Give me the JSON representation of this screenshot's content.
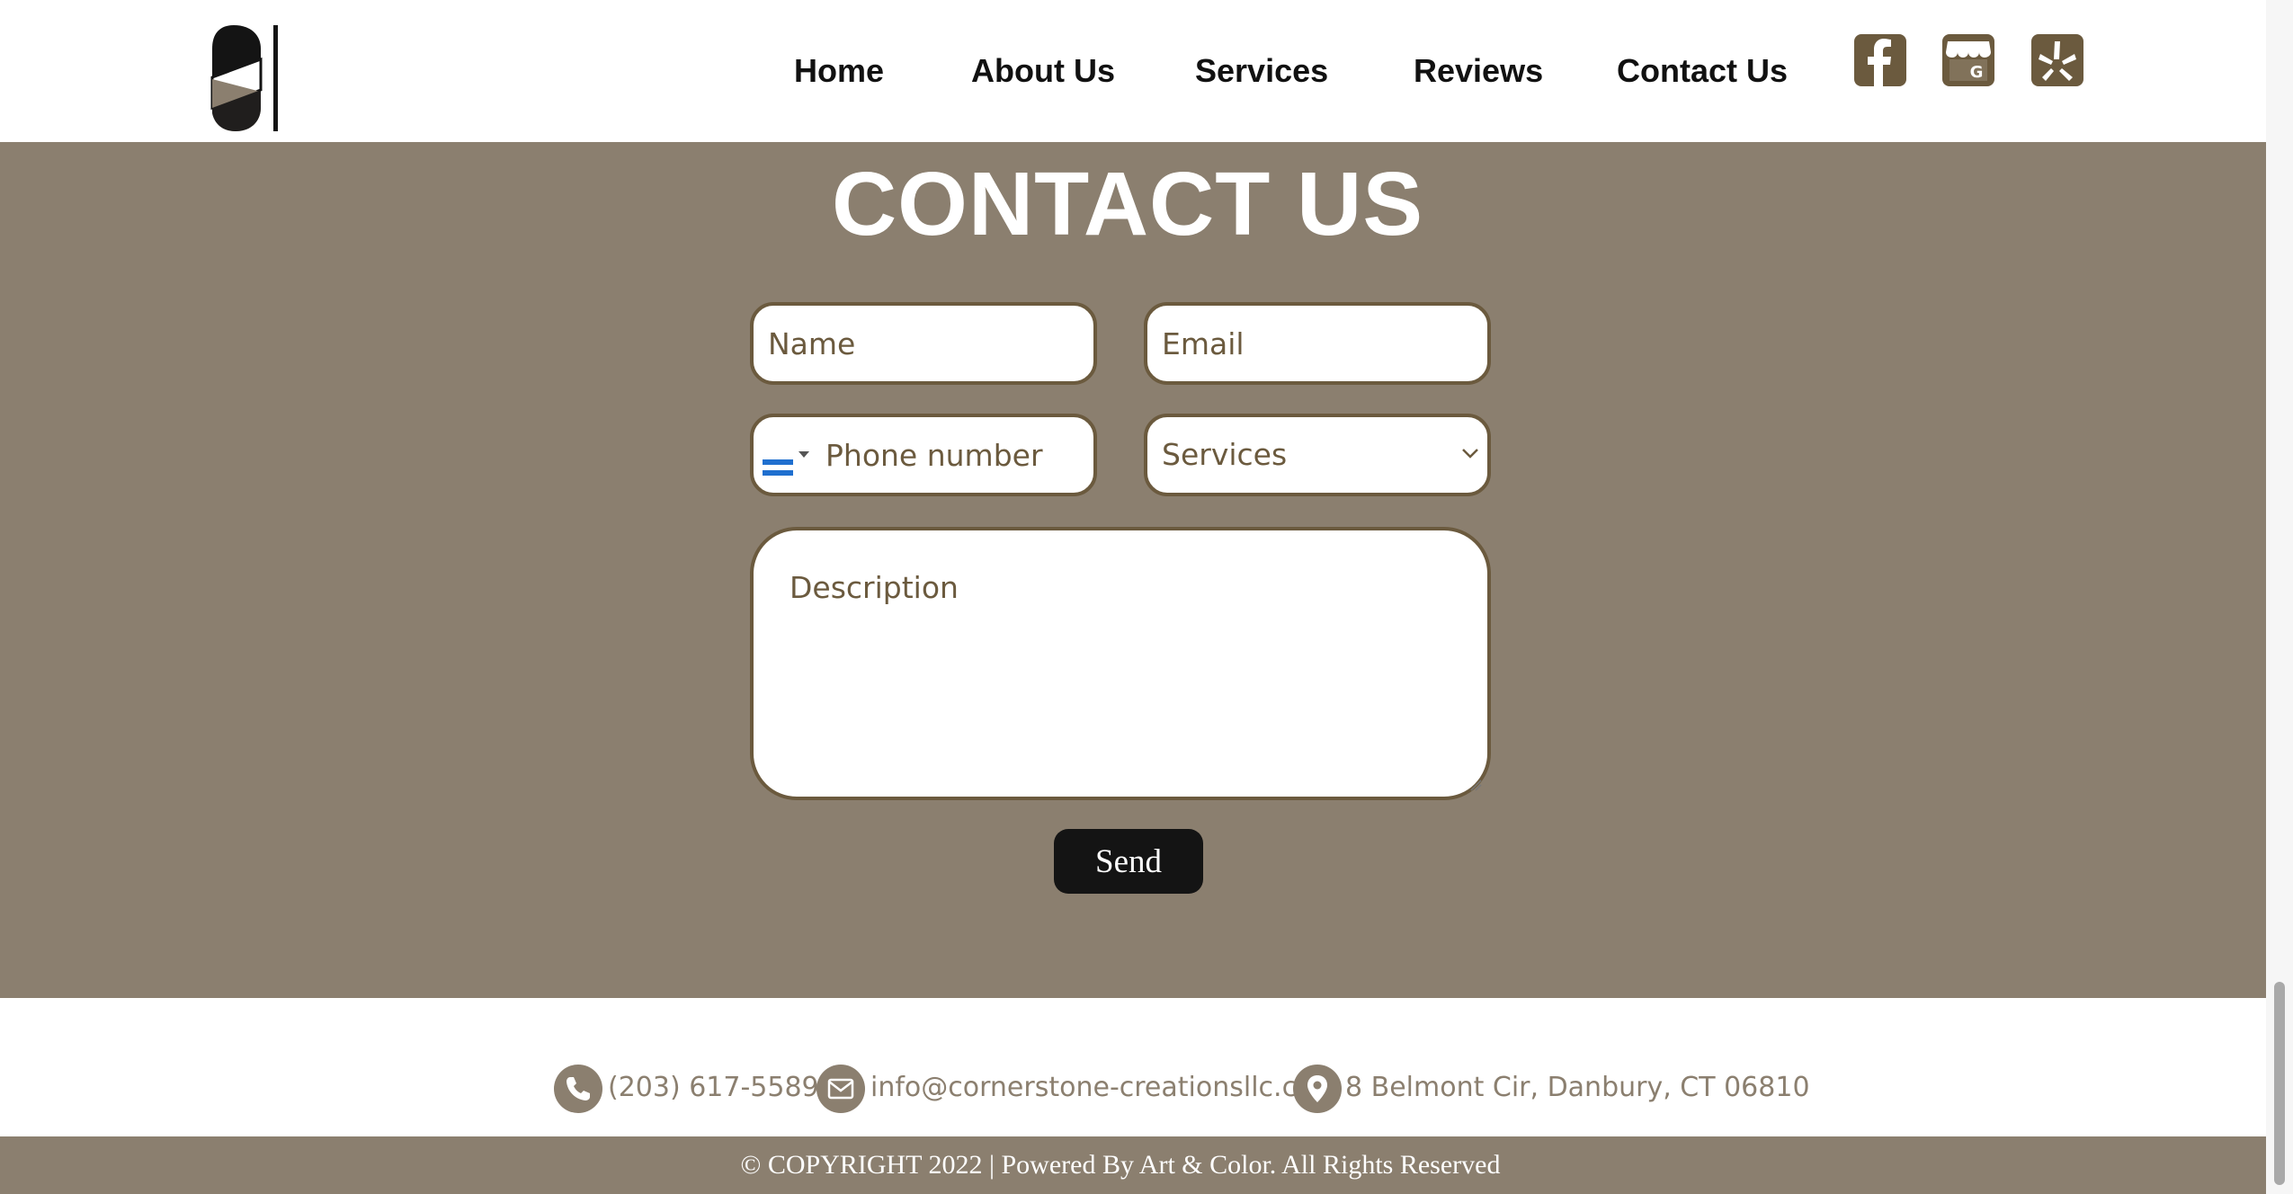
{
  "header": {
    "nav": [
      {
        "label": "Home"
      },
      {
        "label": "About Us"
      },
      {
        "label": "Services"
      },
      {
        "label": "Reviews"
      },
      {
        "label": "Contact Us"
      }
    ],
    "social_icons": [
      "facebook-icon",
      "google-business-icon",
      "yelp-icon"
    ]
  },
  "contact": {
    "title": "CONTACT US",
    "name_placeholder": "Name",
    "email_placeholder": "Email",
    "phone_placeholder": "Phone number",
    "services_selected": "Services",
    "description_placeholder": "Description",
    "send_label": "Send"
  },
  "footer": {
    "phone": "(203) 617-5589",
    "email": "info@cornerstone-creationsllc.com",
    "address": "8 Belmont Cir, Danbury, CT 06810",
    "copyright": "© COPYRIGHT 2022 | Powered By Art & Color. All Rights Reserved"
  },
  "colors": {
    "brand_taupe": "#8b7f6f",
    "brand_brown": "#6b5a3e",
    "button_dark": "#141414",
    "white": "#ffffff"
  }
}
